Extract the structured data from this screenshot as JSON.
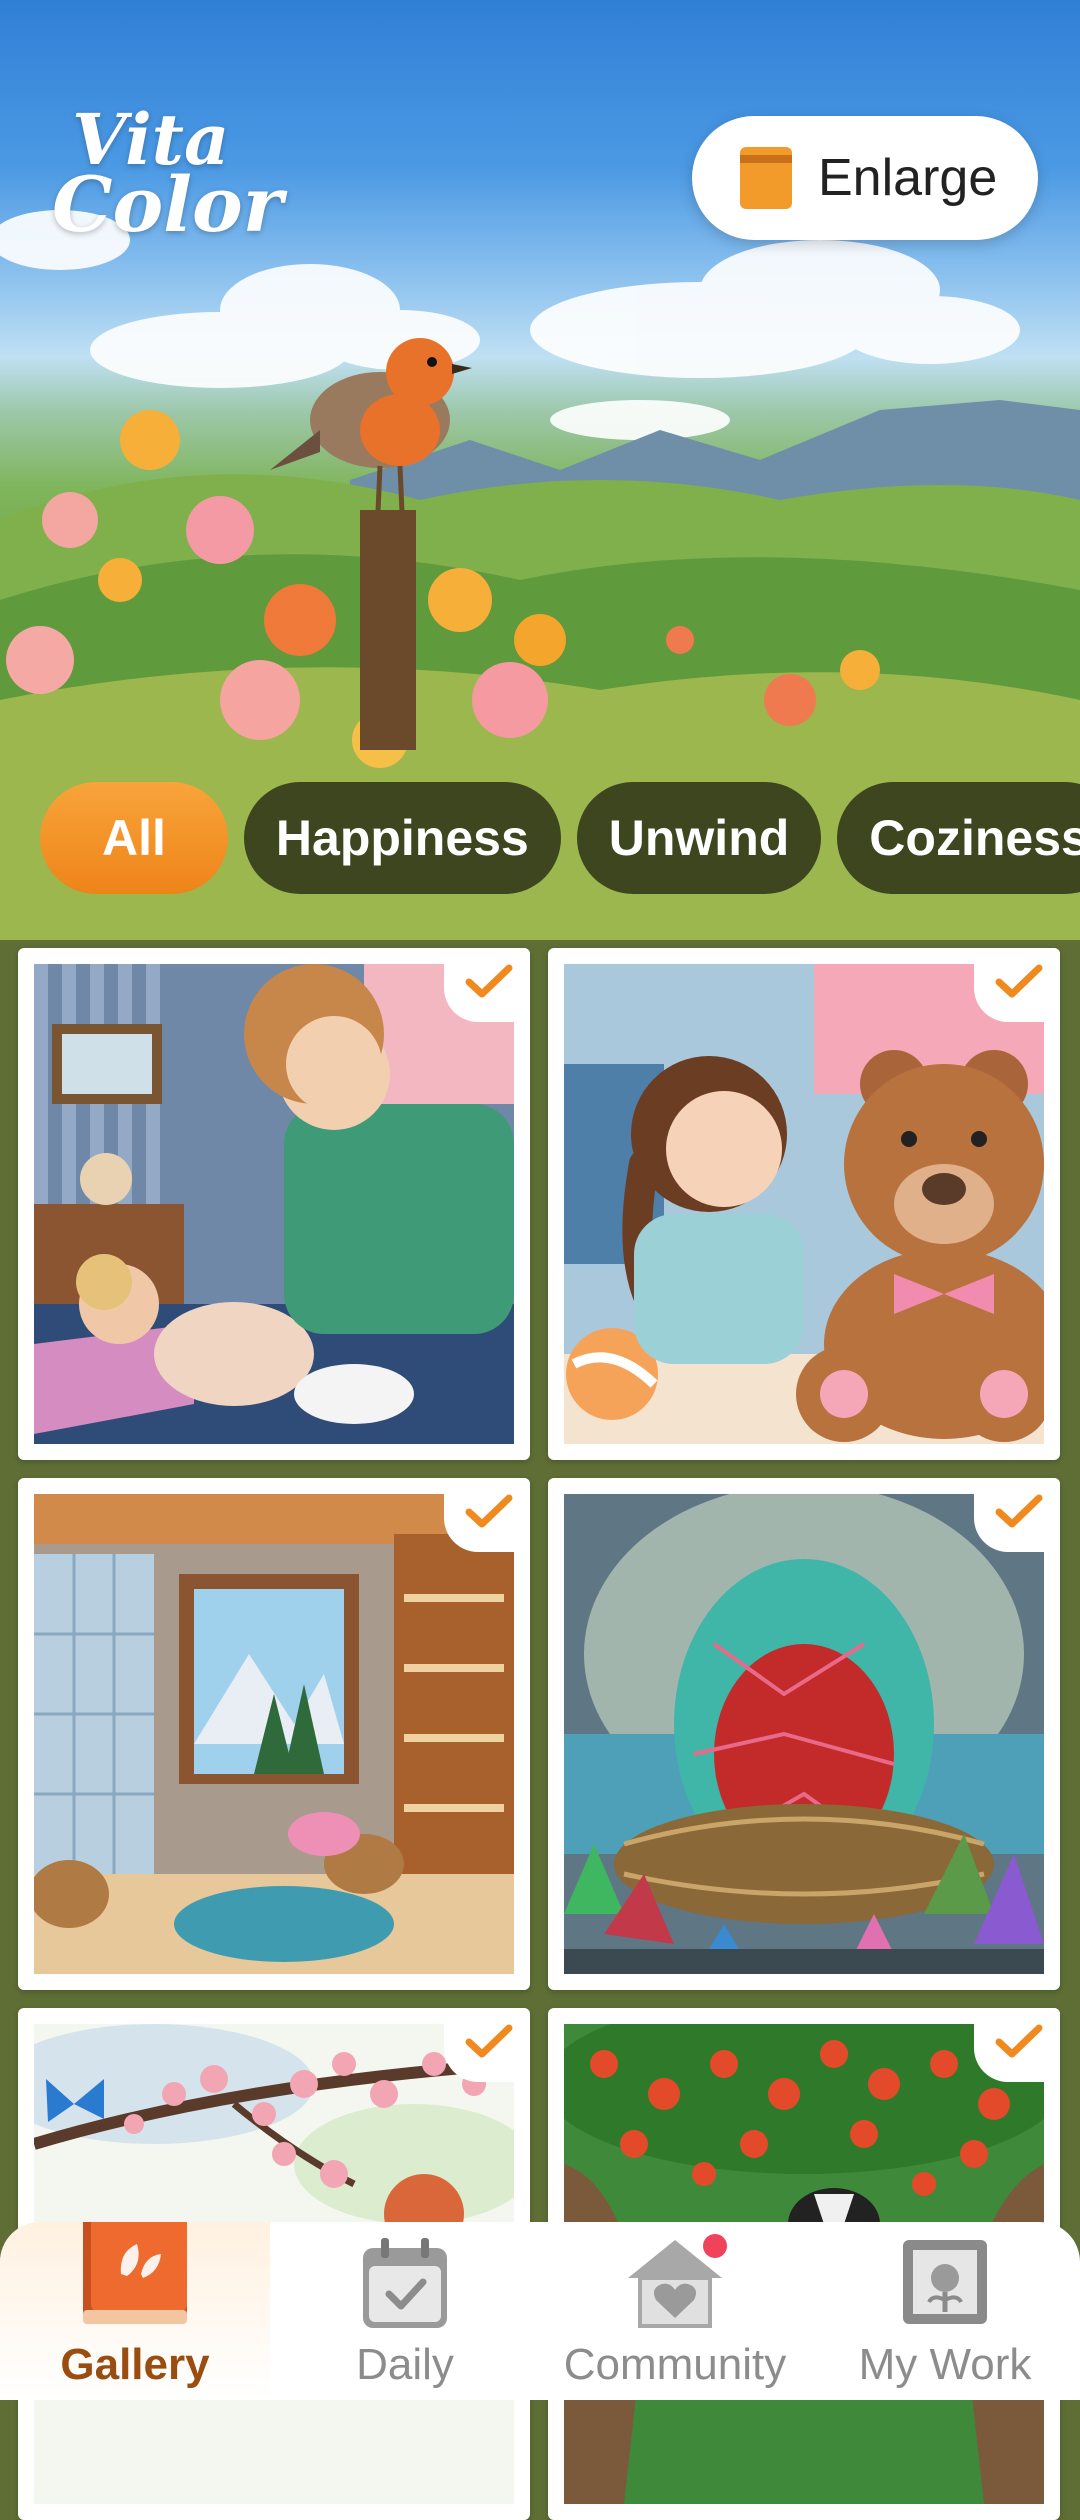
{
  "app": {
    "logo_line1": "Vita",
    "logo_line2": "Color"
  },
  "header": {
    "enlarge_label": "Enlarge"
  },
  "categories": [
    {
      "label": "All",
      "active": true
    },
    {
      "label": "Happiness"
    },
    {
      "label": "Unwind"
    },
    {
      "label": "Coziness"
    }
  ],
  "gallery": [
    {
      "subject": "mother and baby",
      "completed": true
    },
    {
      "subject": "girl and teddy bear",
      "completed": true
    },
    {
      "subject": "cozy bathroom",
      "completed": true
    },
    {
      "subject": "dragon egg in nest",
      "completed": true
    },
    {
      "subject": "cherry blossom with butterfly",
      "completed": true
    },
    {
      "subject": "apple tree with badger",
      "completed": true
    }
  ],
  "nav": [
    {
      "label": "Gallery",
      "icon": "book-icon",
      "active": true
    },
    {
      "label": "Daily",
      "icon": "calendar-icon"
    },
    {
      "label": "Community",
      "icon": "home-heart-icon",
      "badge": true
    },
    {
      "label": "My Work",
      "icon": "frame-icon"
    }
  ],
  "colors": {
    "accent": "#F08A1F",
    "nav_active": "#9A4D10"
  }
}
